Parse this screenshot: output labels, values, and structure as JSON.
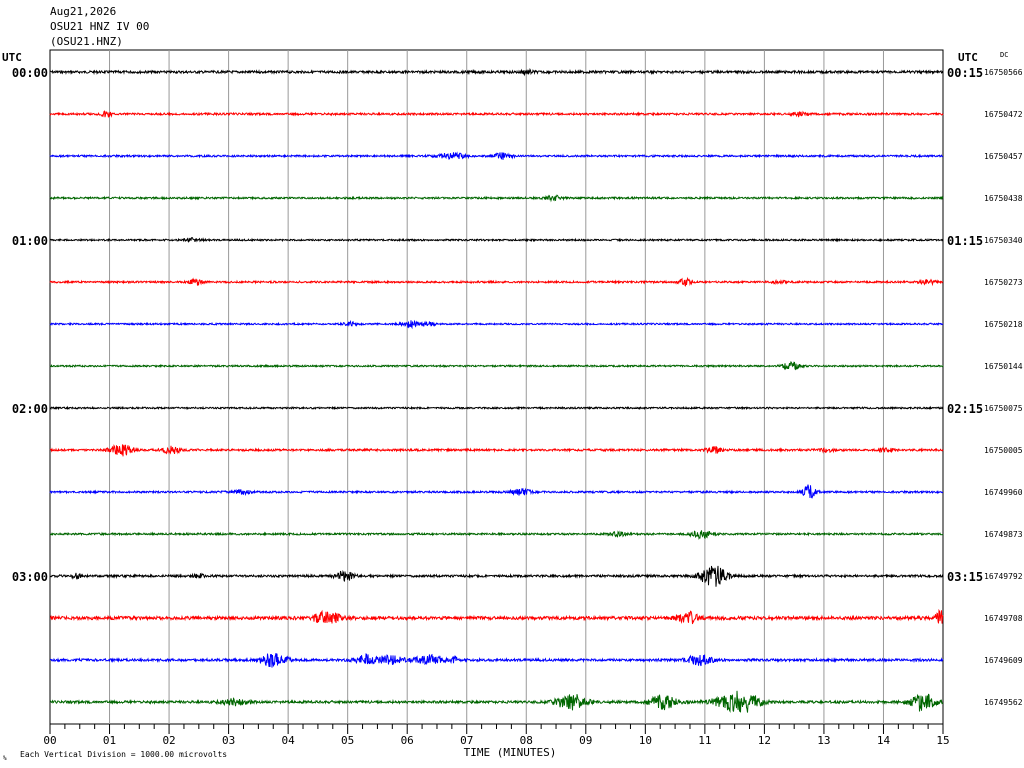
{
  "header": {
    "date": "Aug21,2026",
    "station_line": "OSU21 HNZ IV 00",
    "channel_line": "(OSU21.HNZ)"
  },
  "labels": {
    "utc_left": "UTC",
    "utc_right": "UTC",
    "dc": "DC",
    "xlabel": "TIME (MINUTES)",
    "footer": "Each Vertical Division = 1000.00 microvolts"
  },
  "colors": {
    "cycle": [
      "#000000",
      "#ff0000",
      "#0000ff",
      "#006600"
    ],
    "grid": "#999999",
    "frame": "#000000"
  },
  "chart_data": {
    "type": "line",
    "title": "",
    "xlabel": "TIME (MINUTES)",
    "ylabel": "",
    "xlim": [
      0,
      15
    ],
    "x_ticks": [
      "00",
      "01",
      "02",
      "03",
      "04",
      "05",
      "06",
      "07",
      "08",
      "09",
      "10",
      "11",
      "12",
      "13",
      "14",
      "15"
    ],
    "minor_ticks_per_minute": 4,
    "grid": true,
    "hour_labels_left": [
      "00:00",
      "01:00",
      "02:00",
      "03:00"
    ],
    "hour_labels_right": [
      "00:15",
      "01:15",
      "02:15",
      "03:15"
    ],
    "traces": [
      {
        "color_index": 0,
        "dc": "16750566",
        "noise": 1.2,
        "events": [
          [
            8.0,
            2.0,
            0.15
          ]
        ]
      },
      {
        "color_index": 1,
        "dc": "16750472",
        "noise": 1.0,
        "events": [
          [
            0.95,
            4.0,
            0.1
          ],
          [
            12.6,
            1.5,
            0.2
          ]
        ]
      },
      {
        "color_index": 2,
        "dc": "16750457",
        "noise": 0.9,
        "events": [
          [
            6.75,
            3.0,
            0.3
          ],
          [
            7.6,
            3.0,
            0.2
          ]
        ]
      },
      {
        "color_index": 3,
        "dc": "16750438",
        "noise": 0.9,
        "events": [
          [
            8.45,
            2.5,
            0.2
          ]
        ]
      },
      {
        "color_index": 0,
        "dc": "16750340",
        "noise": 0.8,
        "events": [
          [
            2.4,
            1.5,
            0.2
          ]
        ]
      },
      {
        "color_index": 1,
        "dc": "16750273",
        "noise": 0.9,
        "events": [
          [
            2.45,
            3.0,
            0.15
          ],
          [
            10.65,
            3.5,
            0.15
          ],
          [
            12.25,
            1.5,
            0.15
          ],
          [
            14.75,
            2.0,
            0.2
          ]
        ]
      },
      {
        "color_index": 2,
        "dc": "16750218",
        "noise": 0.8,
        "events": [
          [
            5.05,
            2.0,
            0.15
          ],
          [
            6.05,
            3.0,
            0.2
          ],
          [
            6.35,
            2.0,
            0.15
          ]
        ]
      },
      {
        "color_index": 3,
        "dc": "16750144",
        "noise": 0.8,
        "events": [
          [
            12.45,
            3.5,
            0.2
          ]
        ]
      },
      {
        "color_index": 0,
        "dc": "16750075",
        "noise": 0.8,
        "events": []
      },
      {
        "color_index": 1,
        "dc": "16750005",
        "noise": 1.0,
        "events": [
          [
            1.2,
            6.0,
            0.25
          ],
          [
            2.05,
            4.0,
            0.2
          ],
          [
            11.15,
            3.0,
            0.2
          ],
          [
            13.05,
            1.5,
            0.2
          ],
          [
            14.05,
            1.5,
            0.2
          ]
        ]
      },
      {
        "color_index": 2,
        "dc": "16749960",
        "noise": 0.9,
        "events": [
          [
            3.2,
            2.0,
            0.25
          ],
          [
            7.9,
            3.0,
            0.25
          ],
          [
            12.75,
            7.0,
            0.15
          ]
        ]
      },
      {
        "color_index": 3,
        "dc": "16749873",
        "noise": 0.9,
        "events": [
          [
            9.55,
            2.0,
            0.2
          ],
          [
            10.95,
            4.0,
            0.25
          ]
        ]
      },
      {
        "color_index": 0,
        "dc": "16749792",
        "noise": 1.1,
        "events": [
          [
            0.45,
            2.5,
            0.1
          ],
          [
            2.5,
            2.5,
            0.1
          ],
          [
            4.95,
            5.0,
            0.2
          ],
          [
            11.15,
            11.0,
            0.3
          ]
        ]
      },
      {
        "color_index": 1,
        "dc": "16749708",
        "noise": 1.6,
        "events": [
          [
            4.65,
            6.0,
            0.3
          ],
          [
            10.7,
            6.0,
            0.25
          ],
          [
            14.95,
            7.0,
            0.1
          ]
        ]
      },
      {
        "color_index": 2,
        "dc": "16749609",
        "noise": 1.2,
        "events": [
          [
            3.75,
            7.0,
            0.3
          ],
          [
            5.35,
            5.0,
            0.3
          ],
          [
            5.75,
            4.0,
            0.25
          ],
          [
            6.35,
            5.0,
            0.3
          ],
          [
            6.8,
            3.0,
            0.1
          ],
          [
            10.9,
            5.0,
            0.3
          ]
        ]
      },
      {
        "color_index": 3,
        "dc": "16749562",
        "noise": 1.2,
        "events": [
          [
            3.1,
            3.0,
            0.3
          ],
          [
            8.75,
            8.0,
            0.35
          ],
          [
            10.3,
            7.0,
            0.3
          ],
          [
            11.4,
            6.0,
            0.4
          ],
          [
            11.7,
            8.0,
            0.35
          ],
          [
            14.65,
            9.0,
            0.3
          ]
        ]
      }
    ]
  }
}
